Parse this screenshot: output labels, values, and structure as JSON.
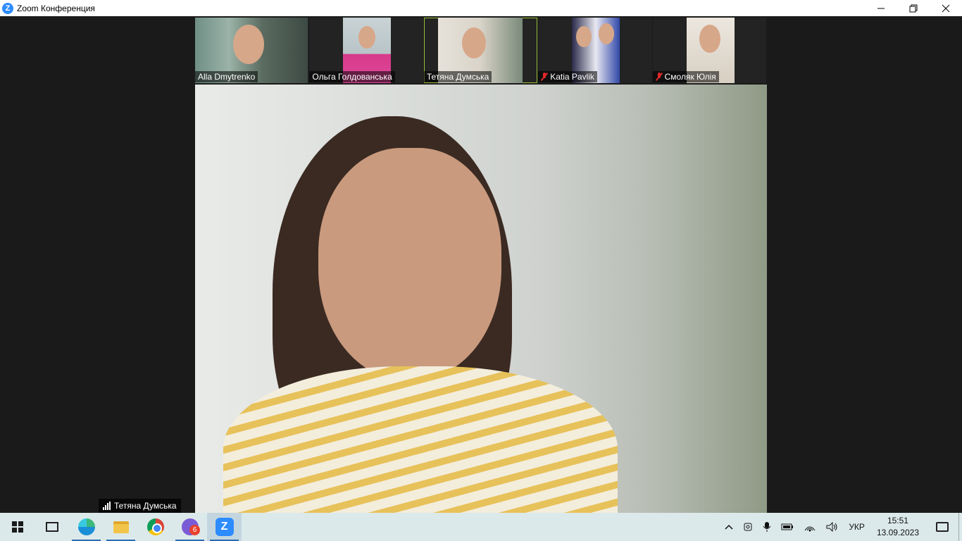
{
  "window": {
    "title": "Zoom Конференция",
    "app_icon_letter": "Z"
  },
  "participants": [
    {
      "name": "Alla Dmytrenko",
      "muted": false,
      "active": false
    },
    {
      "name": "Ольга Голдованська",
      "muted": false,
      "active": false
    },
    {
      "name": "Тетяна Думська",
      "muted": false,
      "active": true
    },
    {
      "name": "Katia Pavlik",
      "muted": true,
      "active": false
    },
    {
      "name": "Смоляк Юлія",
      "muted": true,
      "active": false
    }
  ],
  "main_speaker": {
    "name": "Тетяна Думська"
  },
  "taskbar": {
    "apps": [
      {
        "id": "start",
        "icon": "windows-icon"
      },
      {
        "id": "task-view",
        "icon": "task-view-icon"
      },
      {
        "id": "edge",
        "icon": "edge-icon"
      },
      {
        "id": "file-explorer",
        "icon": "folder-icon"
      },
      {
        "id": "chrome",
        "icon": "chrome-icon"
      },
      {
        "id": "viber",
        "icon": "viber-icon",
        "badge": "6"
      },
      {
        "id": "zoom",
        "icon": "zoom-icon",
        "letter": "Z"
      }
    ],
    "tray": {
      "language": "УКР",
      "time": "15:51",
      "date": "13.09.2023"
    }
  },
  "colors": {
    "active_border": "#9bc23a",
    "zoom_blue": "#2d8cff",
    "muted_red": "#e02828"
  }
}
